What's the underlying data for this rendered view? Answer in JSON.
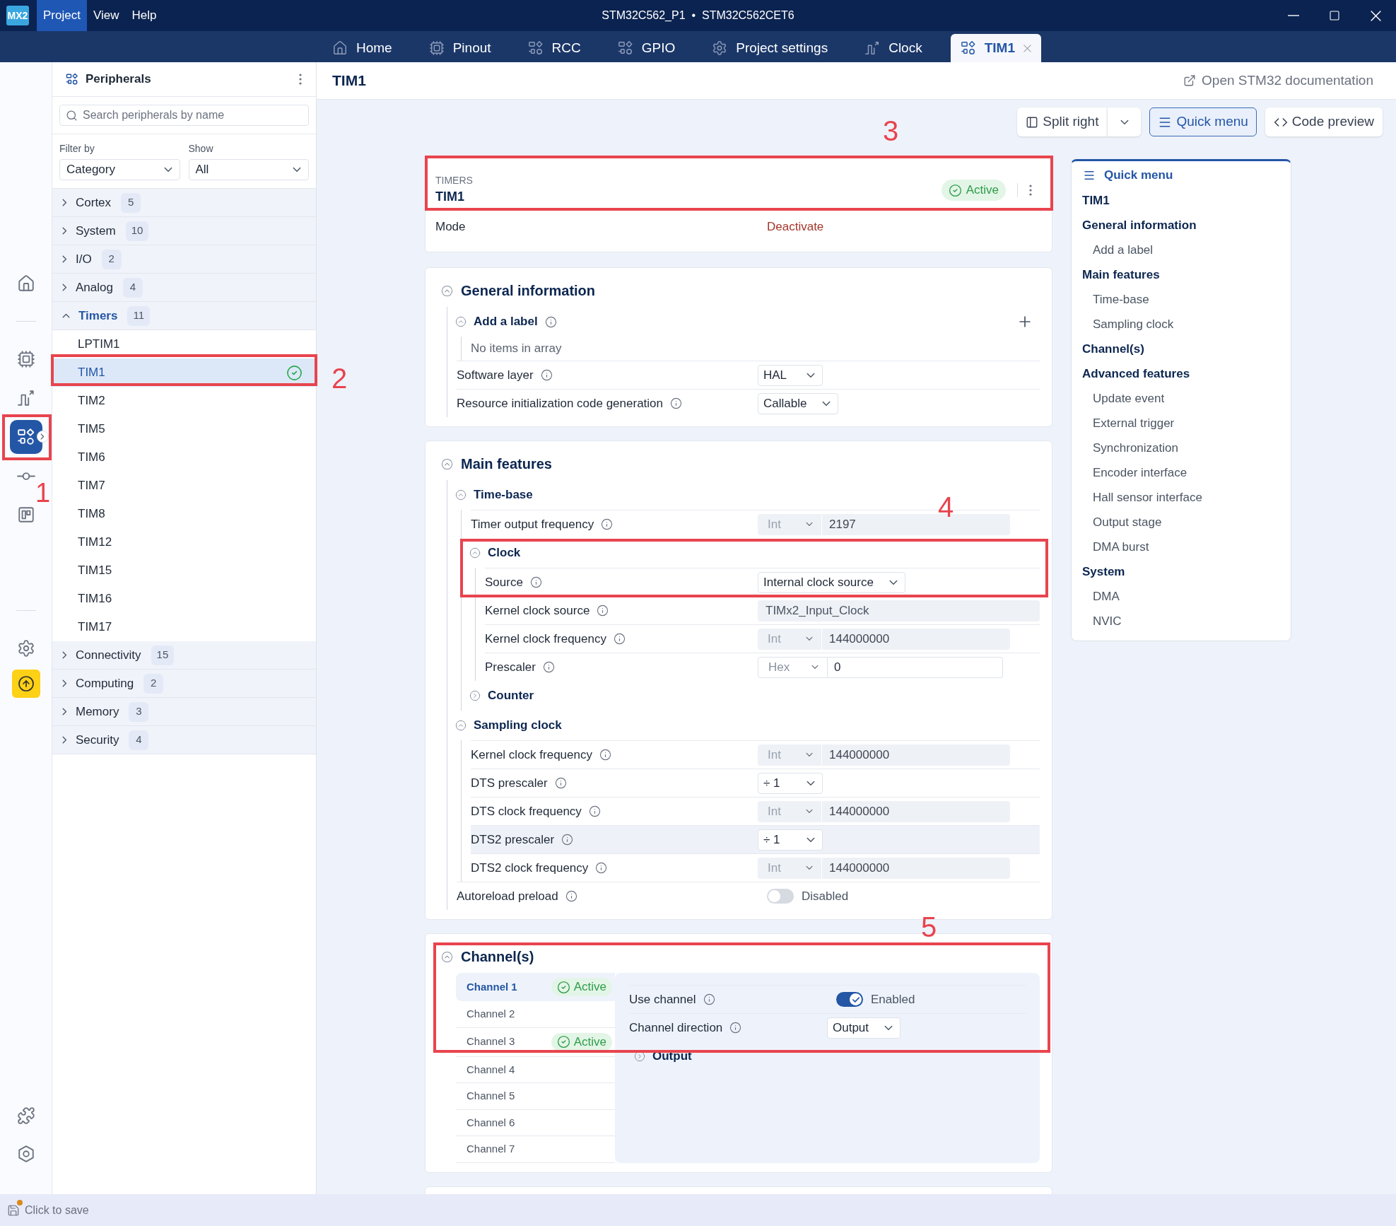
{
  "titlebar": {
    "logo": "MX2",
    "menu": [
      {
        "label": "Project",
        "selected": true
      },
      {
        "label": "View",
        "selected": false
      },
      {
        "label": "Help",
        "selected": false
      }
    ],
    "title": "STM32C562_P1  •  STM32C562CET6"
  },
  "tabs": [
    {
      "label": "Home",
      "selected": false,
      "closable": false
    },
    {
      "label": "Pinout",
      "selected": false,
      "closable": false
    },
    {
      "label": "RCC",
      "selected": false,
      "closable": false
    },
    {
      "label": "GPIO",
      "selected": false,
      "closable": false
    },
    {
      "label": "Project settings",
      "selected": false,
      "closable": false
    },
    {
      "label": "Clock",
      "selected": false,
      "closable": false
    },
    {
      "label": "TIM1",
      "selected": true,
      "closable": true
    }
  ],
  "rail": [
    {
      "items": [
        {
          "selected": false,
          "highlighted": false
        }
      ]
    },
    {
      "items": [
        {
          "selected": false,
          "highlighted": false
        },
        {
          "selected": false,
          "highlighted": false
        },
        {
          "selected": true,
          "highlighted": false
        },
        {
          "selected": false,
          "highlighted": false
        },
        {
          "selected": false,
          "highlighted": false
        }
      ]
    },
    {
      "items": [
        {
          "selected": false,
          "highlighted": false
        },
        {
          "selected": false,
          "highlighted": true
        }
      ]
    },
    {
      "items": [
        {
          "selected": false,
          "highlighted": false
        },
        {
          "selected": false,
          "highlighted": false
        }
      ]
    }
  ],
  "peripherals": {
    "title": "Peripherals",
    "search": {
      "placeholder": "Search peripherals by name"
    },
    "filters": [
      {
        "label": "Filter by",
        "value": "Category"
      },
      {
        "label": "Show",
        "value": "All"
      }
    ],
    "categories": [
      {
        "name": "Cortex",
        "count": "5",
        "expanded": false
      },
      {
        "name": "System",
        "count": "10",
        "expanded": false
      },
      {
        "name": "I/O",
        "count": "2",
        "expanded": false
      },
      {
        "name": "Analog",
        "count": "4",
        "expanded": false
      },
      {
        "name": "Timers",
        "count": "11",
        "expanded": true,
        "children": [
          {
            "name": "LPTIM1",
            "selected": false,
            "active": false
          },
          {
            "name": "TIM1",
            "selected": true,
            "active": true
          },
          {
            "name": "TIM2",
            "selected": false,
            "active": false
          },
          {
            "name": "TIM5",
            "selected": false,
            "active": false
          },
          {
            "name": "TIM6",
            "selected": false,
            "active": false
          },
          {
            "name": "TIM7",
            "selected": false,
            "active": false
          },
          {
            "name": "TIM8",
            "selected": false,
            "active": false
          },
          {
            "name": "TIM12",
            "selected": false,
            "active": false
          },
          {
            "name": "TIM15",
            "selected": false,
            "active": false
          },
          {
            "name": "TIM16",
            "selected": false,
            "active": false
          },
          {
            "name": "TIM17",
            "selected": false,
            "active": false
          }
        ]
      },
      {
        "name": "Connectivity",
        "count": "15",
        "expanded": false
      },
      {
        "name": "Computing",
        "count": "2",
        "expanded": false
      },
      {
        "name": "Memory",
        "count": "3",
        "expanded": false
      },
      {
        "name": "Security",
        "count": "4",
        "expanded": false
      }
    ]
  },
  "page": {
    "title": "TIM1",
    "doc_link": "Open STM32 documentation",
    "toolbar": [
      {
        "kind": "split",
        "label": "Split right",
        "selected": false
      },
      {
        "kind": "menu",
        "label": "Quick menu",
        "selected": true
      },
      {
        "kind": "code",
        "label": "Code preview",
        "selected": false
      }
    ],
    "summary": {
      "category": "TIMERS",
      "name": "TIM1",
      "status": "Active",
      "mode_label": "Mode",
      "mode_action": "Deactivate"
    },
    "sections": [
      {
        "kind": "fields",
        "title": "General information",
        "expanded": true,
        "children": [
          {
            "kind": "group",
            "title": "Add a label",
            "expanded": true,
            "info": true,
            "addable": true,
            "children": [
              {
                "kind": "note",
                "text": "No items in array"
              }
            ]
          },
          {
            "kind": "select",
            "label": "Software layer",
            "value": "HAL"
          },
          {
            "kind": "select",
            "label": "Resource initialization code generation",
            "value": "Callable"
          }
        ]
      },
      {
        "kind": "fields",
        "title": "Main features",
        "expanded": true,
        "children": [
          {
            "kind": "group",
            "title": "Time-base",
            "expanded": true,
            "info": false,
            "children": [
              {
                "kind": "number",
                "label": "Timer output frequency",
                "format": "Int",
                "value": "2197",
                "disabled": true
              },
              {
                "kind": "group",
                "title": "Clock",
                "expanded": true,
                "info": false,
                "children": [
                  {
                    "kind": "select",
                    "label": "Source",
                    "value": "Internal clock source"
                  },
                  {
                    "kind": "text",
                    "label": "Kernel clock source",
                    "value": "TIMx2_Input_Clock",
                    "disabled": true
                  },
                  {
                    "kind": "number",
                    "label": "Kernel clock frequency",
                    "format": "Int",
                    "value": "144000000",
                    "disabled": true
                  },
                  {
                    "kind": "number",
                    "label": "Prescaler",
                    "format": "Hex",
                    "value": "0",
                    "disabled": false
                  }
                ]
              },
              {
                "kind": "group",
                "title": "Counter",
                "expanded": false,
                "info": false
              }
            ]
          },
          {
            "kind": "group",
            "title": "Sampling clock",
            "expanded": true,
            "info": false,
            "children": [
              {
                "kind": "number",
                "label": "Kernel clock frequency",
                "format": "Int",
                "value": "144000000",
                "disabled": true,
                "highlighted": false
              },
              {
                "kind": "select",
                "label": "DTS prescaler",
                "value": "÷ 1",
                "highlighted": false
              },
              {
                "kind": "number",
                "label": "DTS clock frequency",
                "format": "Int",
                "value": "144000000",
                "disabled": true,
                "highlighted": false
              },
              {
                "kind": "select",
                "label": "DTS2 prescaler",
                "value": "÷ 1",
                "highlighted": true
              },
              {
                "kind": "number",
                "label": "DTS2 clock frequency",
                "format": "Int",
                "value": "144000000",
                "disabled": true,
                "highlighted": false
              }
            ]
          },
          {
            "kind": "toggle",
            "label": "Autoreload preload",
            "on": false,
            "value": "Disabled"
          }
        ]
      },
      {
        "kind": "channels",
        "title": "Channel(s)",
        "expanded": true,
        "channels": [
          {
            "name": "Channel 1",
            "selected": true,
            "status": "Active"
          },
          {
            "name": "Channel 2",
            "selected": false
          },
          {
            "name": "Channel 3",
            "selected": false,
            "status": "Active"
          },
          {
            "name": "Channel 4",
            "selected": false
          },
          {
            "name": "Channel 5",
            "selected": false
          },
          {
            "name": "Channel 6",
            "selected": false
          },
          {
            "name": "Channel 7",
            "selected": false
          }
        ],
        "detail": [
          {
            "kind": "toggle",
            "label": "Use channel",
            "on": true,
            "value": "Enabled"
          },
          {
            "kind": "select",
            "label": "Channel direction",
            "value": "Output"
          },
          {
            "kind": "group",
            "title": "Output",
            "expanded": false,
            "info": false
          }
        ]
      }
    ]
  },
  "quick_menu": {
    "title": "Quick menu",
    "items": [
      {
        "label": "TIM1"
      },
      {
        "label": "General information",
        "children": [
          {
            "label": "Add a label"
          }
        ]
      },
      {
        "label": "Main features",
        "children": [
          {
            "label": "Time-base"
          },
          {
            "label": "Sampling clock"
          }
        ]
      },
      {
        "label": "Channel(s)"
      },
      {
        "label": "Advanced features",
        "children": [
          {
            "label": "Update event"
          },
          {
            "label": "External trigger"
          },
          {
            "label": "Synchronization"
          },
          {
            "label": "Encoder interface"
          },
          {
            "label": "Hall sensor interface"
          },
          {
            "label": "Output stage"
          },
          {
            "label": "DMA burst"
          }
        ]
      },
      {
        "label": "System",
        "children": [
          {
            "label": "DMA"
          },
          {
            "label": "NVIC"
          }
        ]
      }
    ]
  },
  "status_bar": {
    "save": "Click to save",
    "unsaved": true
  },
  "annotations": [
    {
      "label": "1"
    },
    {
      "label": "2"
    },
    {
      "label": "3"
    },
    {
      "label": "4"
    },
    {
      "label": "5"
    }
  ]
}
